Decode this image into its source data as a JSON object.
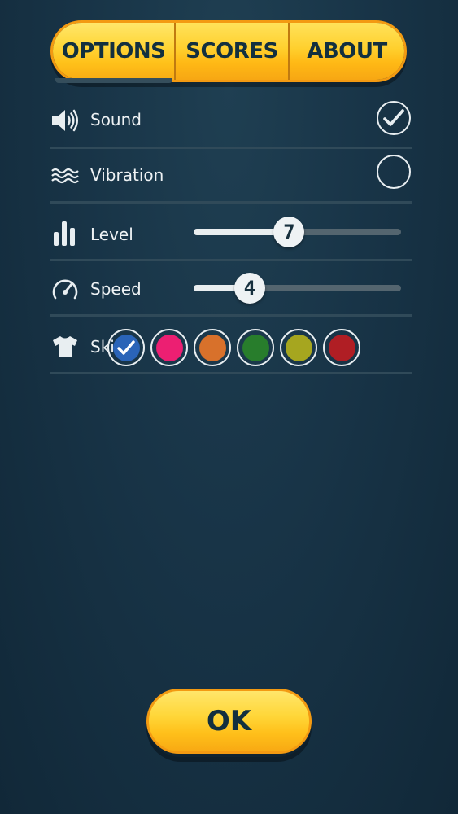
{
  "tabs": [
    {
      "label": "OPTIONS",
      "active": true
    },
    {
      "label": "SCORES",
      "active": false
    },
    {
      "label": "ABOUT",
      "active": false
    }
  ],
  "settings": {
    "sound": {
      "label": "Sound",
      "icon": "speaker-icon",
      "checked": true
    },
    "vibration": {
      "label": "Vibration",
      "icon": "vibration-waves-icon",
      "checked": false
    },
    "level": {
      "label": "Level",
      "icon": "bar-levels-icon",
      "value": "7",
      "fraction": 0.46
    },
    "speed": {
      "label": "Speed",
      "icon": "speedometer-icon",
      "value": "4",
      "fraction": 0.27
    },
    "skins": {
      "label": "Skins",
      "icon": "tshirt-icon",
      "options": [
        {
          "name": "blue",
          "color": "#2a64b8",
          "selected": true
        },
        {
          "name": "pink",
          "color": "#ec1f72",
          "selected": false
        },
        {
          "name": "orange",
          "color": "#d8712b",
          "selected": false
        },
        {
          "name": "green",
          "color": "#287d2c",
          "selected": false
        },
        {
          "name": "olive",
          "color": "#a6a61f",
          "selected": false
        },
        {
          "name": "red",
          "color": "#b01e24",
          "selected": false
        }
      ]
    }
  },
  "ok_label": "OK",
  "colors": {
    "accent": "#ffcb26",
    "accent_border": "#f39a12",
    "button_text": "#13303f",
    "background": "#183447"
  }
}
